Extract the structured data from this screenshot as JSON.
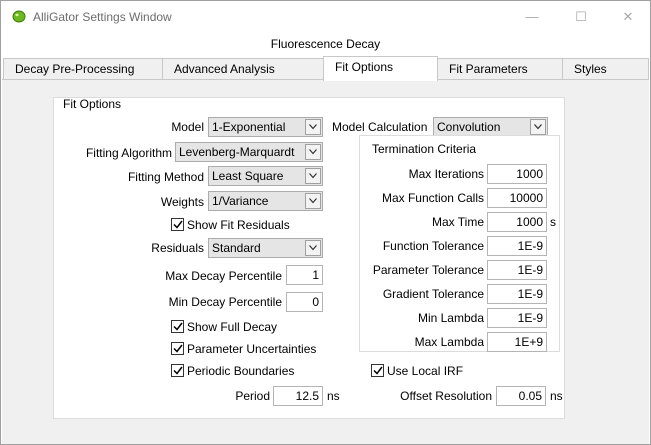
{
  "window": {
    "title": "AlliGator Settings Window",
    "minimize_glyph": "—",
    "maximize_glyph": "☐",
    "close_glyph": "✕"
  },
  "group_title": "Fluorescence Decay",
  "tabs": [
    {
      "label": "Decay Pre-Processing",
      "active": false
    },
    {
      "label": "Advanced Analysis",
      "active": false
    },
    {
      "label": "Fit Options",
      "active": true
    },
    {
      "label": "Fit Parameters",
      "active": false
    },
    {
      "label": "Styles",
      "active": false
    }
  ],
  "fit_options": {
    "section_label": "Fit Options",
    "model": {
      "label": "Model",
      "value": "1-Exponential"
    },
    "model_calculation": {
      "label": "Model Calculation",
      "value": "Convolution"
    },
    "fitting_algorithm": {
      "label": "Fitting Algorithm",
      "value": "Levenberg-Marquardt"
    },
    "fitting_method": {
      "label": "Fitting Method",
      "value": "Least Square"
    },
    "weights": {
      "label": "Weights",
      "value": "1/Variance"
    },
    "show_fit_residuals": {
      "label": "Show Fit Residuals",
      "checked": true
    },
    "residuals": {
      "label": "Residuals",
      "value": "Standard"
    },
    "max_decay_percentile": {
      "label": "Max Decay Percentile",
      "value": "1"
    },
    "min_decay_percentile": {
      "label": "Min Decay Percentile",
      "value": "0"
    },
    "show_full_decay": {
      "label": "Show Full Decay",
      "checked": true
    },
    "parameter_uncertainties": {
      "label": "Parameter Uncertainties",
      "checked": true
    },
    "periodic_boundaries": {
      "label": "Periodic Boundaries",
      "checked": true
    },
    "period": {
      "label": "Period",
      "value": "12.5",
      "unit": "ns"
    },
    "use_local_irf": {
      "label": "Use Local IRF",
      "checked": true
    },
    "offset_resolution": {
      "label": "Offset Resolution",
      "value": "0.05",
      "unit": "ns"
    }
  },
  "termination": {
    "title": "Termination Criteria",
    "max_iterations": {
      "label": "Max Iterations",
      "value": "1000"
    },
    "max_function_calls": {
      "label": "Max Function Calls",
      "value": "10000"
    },
    "max_time": {
      "label": "Max Time",
      "value": "1000",
      "unit": "s"
    },
    "function_tolerance": {
      "label": "Function Tolerance",
      "value": "1E-9"
    },
    "parameter_tolerance": {
      "label": "Parameter Tolerance",
      "value": "1E-9"
    },
    "gradient_tolerance": {
      "label": "Gradient Tolerance",
      "value": "1E-9"
    },
    "min_lambda": {
      "label": "Min Lambda",
      "value": "1E-9"
    },
    "max_lambda": {
      "label": "Max Lambda",
      "value": "1E+9"
    }
  },
  "colors": {
    "accent_icon": "#6bb81f",
    "pane_bg": "#f0f0f0"
  },
  "icons": {
    "app": "alligator-icon",
    "dropdown": "chevron-down-icon",
    "check": "checkmark-icon"
  }
}
